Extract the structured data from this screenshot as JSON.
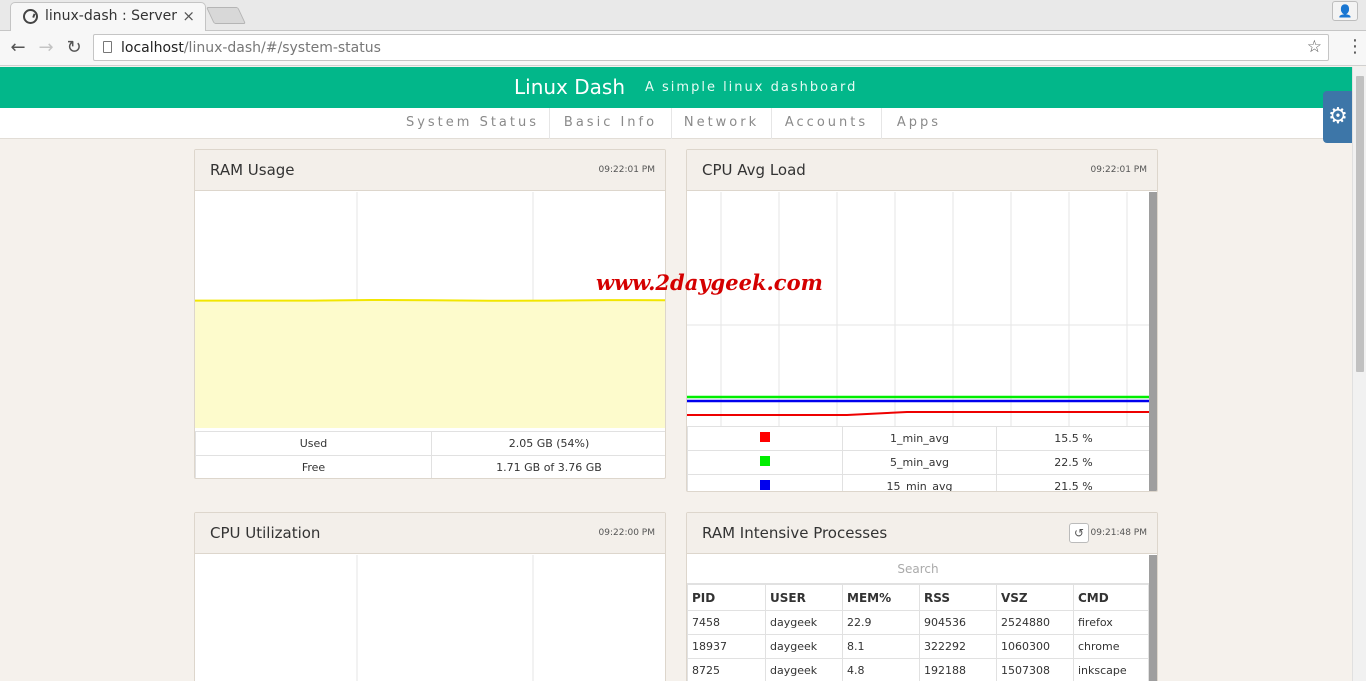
{
  "browser": {
    "tab_title": "linux-dash : Server /",
    "tab_close": "×",
    "url_host": "localhost",
    "url_path": "/linux-dash/#/system-status",
    "back": "←",
    "forward": "→",
    "reload": "↻",
    "star": "☆",
    "menu": "⋮",
    "profile": "👤"
  },
  "header": {
    "title": "Linux Dash",
    "subtitle": "A simple linux dashboard"
  },
  "nav": {
    "items": [
      "System Status",
      "Basic Info",
      "Network",
      "Accounts",
      "Apps"
    ]
  },
  "settings_icon": "⚙",
  "watermark": "www.2daygeek.com",
  "ram_usage": {
    "title": "RAM Usage",
    "time": "09:22:01 PM",
    "rows": [
      {
        "label": "Used",
        "value": "2.05 GB (54%)"
      },
      {
        "label": "Free",
        "value": "1.71 GB of 3.76 GB"
      }
    ],
    "used_fraction": 0.54,
    "colors": {
      "line": "#f2e600",
      "fill": "#fdfbcc"
    }
  },
  "cpu_avg_load": {
    "title": "CPU Avg Load",
    "time": "09:22:01 PM",
    "rows": [
      {
        "color": "#ff0000",
        "label": "1_min_avg",
        "value": "15.5 %"
      },
      {
        "color": "#00ee00",
        "label": "5_min_avg",
        "value": "22.5 %"
      },
      {
        "color": "#0000ee",
        "label": "15_min_avg",
        "value": "21.5 %"
      }
    ]
  },
  "cpu_utilization": {
    "title": "CPU Utilization",
    "time": "09:22:00 PM"
  },
  "ram_processes": {
    "title": "RAM Intensive Processes",
    "time": "09:21:48 PM",
    "refresh_icon": "↺",
    "search_placeholder": "Search",
    "columns": [
      "PID",
      "USER",
      "MEM%",
      "RSS",
      "VSZ",
      "CMD"
    ],
    "rows": [
      [
        "7458",
        "daygeek",
        "22.9",
        "904536",
        "2524880",
        "firefox"
      ],
      [
        "18937",
        "daygeek",
        "8.1",
        "322292",
        "1060300",
        "chrome"
      ],
      [
        "8725",
        "daygeek",
        "4.8",
        "192188",
        "1507308",
        "inkscape"
      ]
    ]
  }
}
